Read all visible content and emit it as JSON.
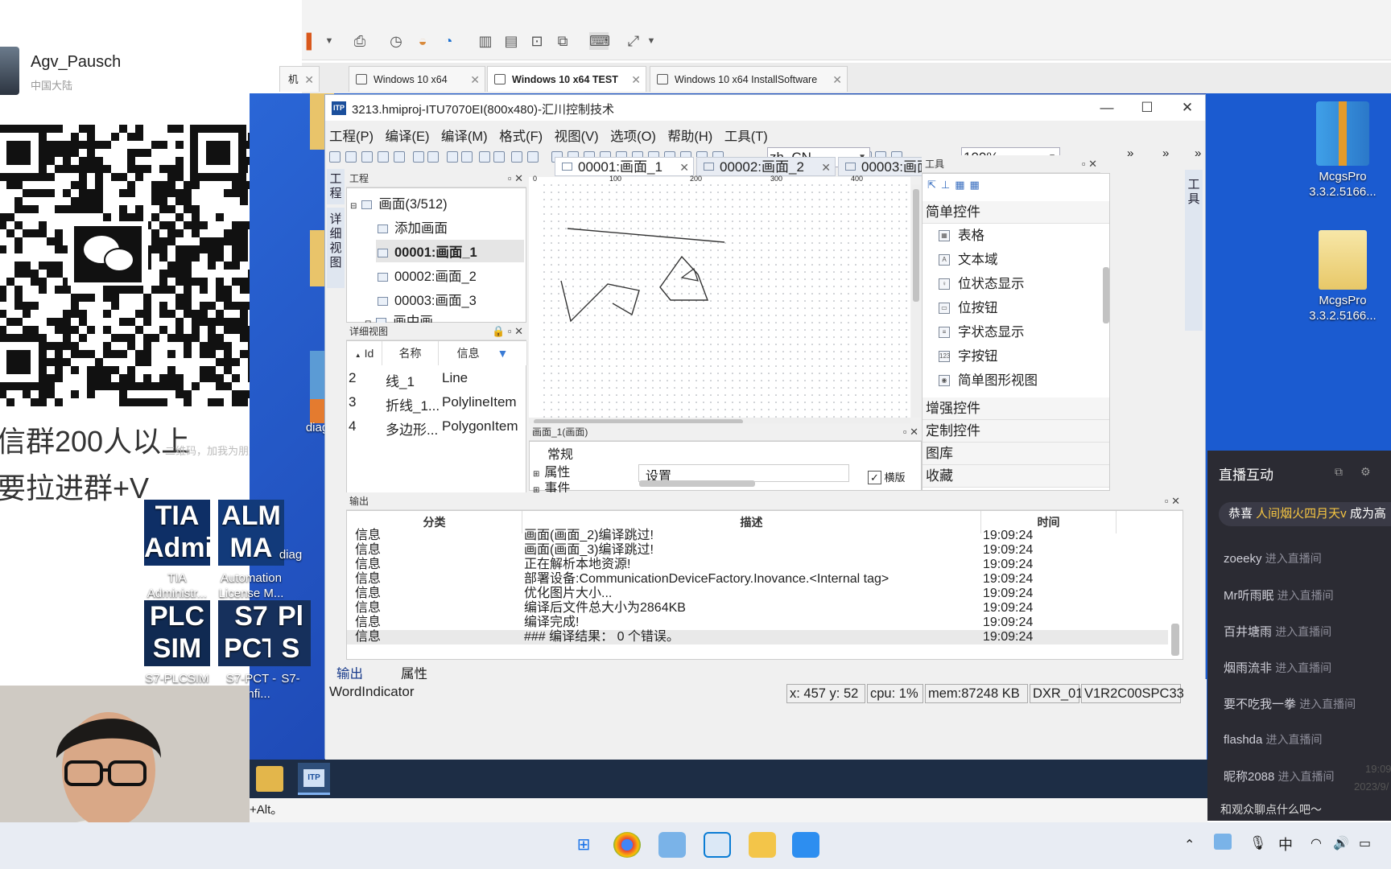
{
  "promo": {
    "username": "Agv_Pausch",
    "region": "中国大陆",
    "line1": "信群200人以上",
    "line2": "要拉进群+V",
    "faint": "二维码，加我为朋友。"
  },
  "vm_tabs": [
    {
      "label": "机",
      "active": false
    },
    {
      "label": "Windows 10 x64",
      "active": false
    },
    {
      "label": "Windows 10 x64 TEST",
      "active": true
    },
    {
      "label": "Windows 10 x64 InstallSoftware",
      "active": false
    }
  ],
  "desktop_icons": {
    "tia": "TIA\nAdministr...",
    "alm": "Automation\nLicense M...",
    "diag1": "diag",
    "diag2": "diag",
    "plcsim": "S7-PLCSIM",
    "pct": "S7-PCT -\nConfi...",
    "s7x": "S7-",
    "mcgs1": "McgsPro\n3.3.2.5166...",
    "mcgs2": "McgsPro\n3.3.2.5166...",
    "tile_tia": "TIA\nAdmin",
    "tile_alm": "ALM\nMA",
    "tile_plcsim": "PLC\nSIM",
    "tile_pct": "S7\nPCT",
    "tile_pl": "Pl\nS"
  },
  "itp": {
    "title": "3213.hmiproj-ITU7070EI(800x480)-汇川控制技术",
    "menu": [
      "工程(P)",
      "编译(E)",
      "编译(M)",
      "格式(F)",
      "视图(V)",
      "选项(O)",
      "帮助(H)",
      "工具(T)"
    ],
    "lang": "zh_CN",
    "zoom": "100%",
    "left_vtabs": [
      "工程",
      "详细视图"
    ],
    "right_vtab": "工具",
    "project_panel_title": "工程",
    "tree": [
      "画面(3/512)",
      "添加画面",
      "00001:画面_1",
      "00002:画面_2",
      "00003:画面_3",
      "画中画"
    ],
    "detail_panel_title": "详细视图",
    "detail_headers": [
      "Id",
      "名称",
      "信息"
    ],
    "detail_rows": [
      {
        "id": "2",
        "name": "线_1",
        "info": "Line"
      },
      {
        "id": "3",
        "name": "折线_1...",
        "info": "PolylineItem"
      },
      {
        "id": "4",
        "name": "多边形...",
        "info": "PolygonItem"
      }
    ],
    "canvas_tabs": [
      "00001:画面_1",
      "00002:画面_2",
      "00003:画面_3"
    ],
    "ruler_marks": [
      "0",
      "100",
      "200",
      "300",
      "400"
    ],
    "vruler_marks": [
      "0",
      "100",
      "200"
    ],
    "props_title": "画面_1(画面)",
    "props_items": [
      "常规",
      "属性",
      "事件"
    ],
    "props_setting": "设置",
    "props_check": "横版",
    "tools_title": "工具",
    "tools_section": "简单控件",
    "tools_items": [
      "表格",
      "文本域",
      "位状态显示",
      "位按钮",
      "字状态显示",
      "字按钮",
      "简单图形视图"
    ],
    "tools_sections_more": [
      "增强控件",
      "定制控件",
      "图库",
      "收藏"
    ],
    "output_title": "输出",
    "output_headers": [
      "分类",
      "描述",
      "时间"
    ],
    "output_rows": [
      {
        "cat": "信息",
        "desc": "画面(画面_2)编译跳过!",
        "time": "19:09:24"
      },
      {
        "cat": "信息",
        "desc": "画面(画面_3)编译跳过!",
        "time": "19:09:24"
      },
      {
        "cat": "信息",
        "desc": "正在解析本地资源!",
        "time": "19:09:24"
      },
      {
        "cat": "信息",
        "desc": "部署设备:CommunicationDeviceFactory.Inovance.<Internal tag>",
        "time": "19:09:24"
      },
      {
        "cat": "信息",
        "desc": "优化图片大小...",
        "time": "19:09:24"
      },
      {
        "cat": "信息",
        "desc": "编译后文件总大小为2864KB",
        "time": "19:09:24"
      },
      {
        "cat": "信息",
        "desc": "编译完成!",
        "time": "19:09:24"
      },
      {
        "cat": "信息",
        "desc": "### 编译结果：  0 个错误。",
        "time": "19:09:24"
      }
    ],
    "bottom_tabs": [
      "输出",
      "属性"
    ],
    "status_left": "WordIndicator",
    "status_boxes": [
      "x: 457 y:  52",
      "cpu:  1%",
      "mem:87248 KB",
      "DXR_01",
      "V1R2C00SPC33"
    ]
  },
  "hint": "+Alt。",
  "live": {
    "title": "直播互动",
    "banner_prefix": "恭喜 ",
    "banner_name": "人间烟火四月天v",
    "banner_suffix": " 成为高",
    "messages": [
      {
        "user": "zoeeky",
        "text": "进入直播间"
      },
      {
        "user": "Mr听雨眠",
        "text": "进入直播间"
      },
      {
        "user": "百井塘雨",
        "text": "进入直播间"
      },
      {
        "user": "烟雨流非",
        "text": "进入直播间"
      },
      {
        "user": "要不吃我一拳",
        "text": "进入直播间"
      },
      {
        "user": "flashda",
        "text": "进入直播间"
      },
      {
        "user": "昵称2088",
        "text": "进入直播间"
      }
    ],
    "prompt": "和观众聊点什么吧～",
    "clock": "19:09",
    "date": "2023/9/"
  },
  "tray": {
    "ime": "中"
  }
}
